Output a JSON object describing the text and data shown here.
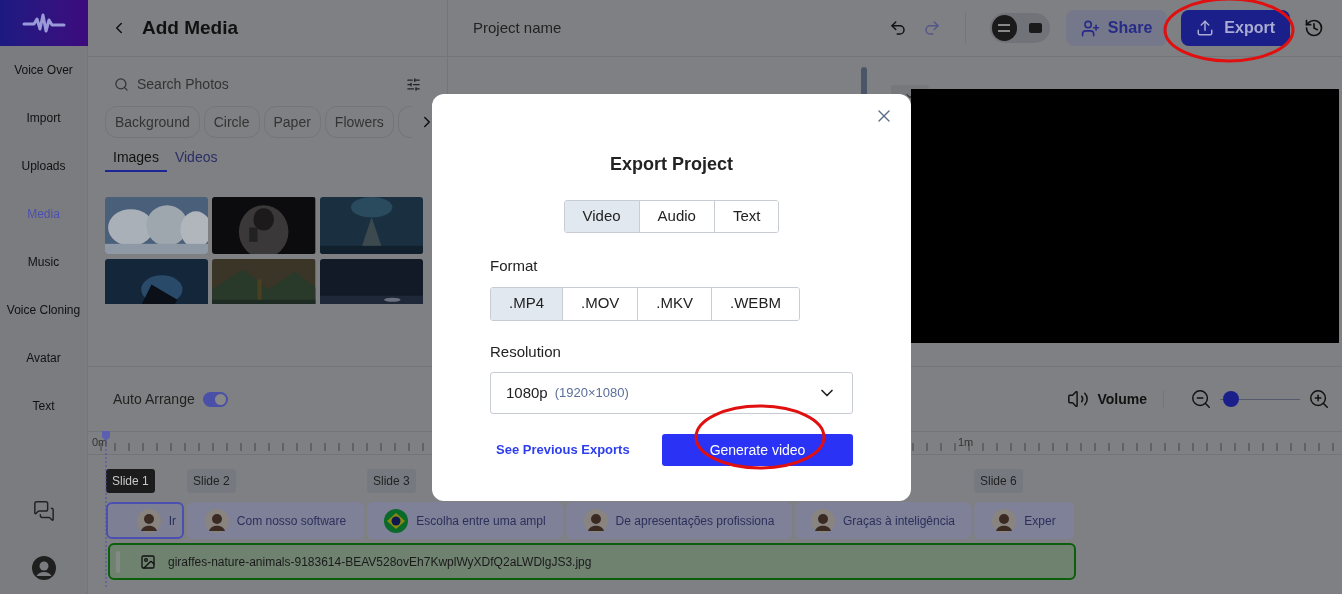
{
  "sidebar": {
    "items": [
      {
        "label": "Voice Over",
        "selected": false
      },
      {
        "label": "Import",
        "selected": false
      },
      {
        "label": "Uploads",
        "selected": false
      },
      {
        "label": "Media",
        "selected": true
      },
      {
        "label": "Music",
        "selected": false
      },
      {
        "label": "Voice Cloning",
        "selected": false
      },
      {
        "label": "Avatar",
        "selected": false
      },
      {
        "label": "Text",
        "selected": false
      }
    ]
  },
  "media_panel": {
    "title": "Add Media",
    "search": {
      "placeholder": "Search Photos"
    },
    "chips": [
      "Background",
      "Circle",
      "Paper",
      "Flowers"
    ],
    "tabs": [
      {
        "label": "Images",
        "selected": true
      },
      {
        "label": "Videos",
        "selected": false
      }
    ]
  },
  "header": {
    "project_name": "Project name",
    "view_modes": [
      {
        "selected": true
      },
      {
        "selected": false
      }
    ],
    "share": "Share",
    "export": "Export"
  },
  "timeline": {
    "auto_arrange": {
      "label": "Auto Arrange",
      "on": true
    },
    "volume": "Volume",
    "zoom": {
      "level": 0.05
    },
    "ruler_labels": [
      "0m",
      "1m"
    ],
    "slides": [
      {
        "label": "Slide 1",
        "selected": true,
        "clip": {
          "text": "Ir",
          "kind": "person"
        }
      },
      {
        "label": "Slide 2",
        "selected": false,
        "clip": {
          "text": "Com nosso software",
          "kind": "person"
        }
      },
      {
        "label": "Slide 3",
        "selected": false,
        "clip": {
          "text": "Escolha entre uma ampl",
          "kind": "flag"
        }
      },
      {
        "selected": false,
        "clip": {
          "text": "De apresentações profissiona",
          "kind": "person"
        }
      },
      {
        "selected": false,
        "clip": {
          "text": "Graças à inteligência",
          "kind": "person"
        }
      },
      {
        "label": "Slide 6",
        "selected": false,
        "clip": {
          "text": "Exper",
          "kind": "person"
        }
      }
    ],
    "media_track": {
      "file": "giraffes-nature-animals-9183614-BEAV528ovEh7KwplWyXDfQ2aLWDlgJS3.jpg"
    }
  },
  "dialog": {
    "title": "Export Project",
    "type_tabs": [
      {
        "label": "Video",
        "selected": true
      },
      {
        "label": "Audio",
        "selected": false
      },
      {
        "label": "Text",
        "selected": false
      }
    ],
    "format_label": "Format",
    "formats": [
      {
        "label": ".MP4",
        "selected": true
      },
      {
        "label": ".MOV",
        "selected": false
      },
      {
        "label": ".MKV",
        "selected": false
      },
      {
        "label": ".WEBM",
        "selected": false
      }
    ],
    "resolution_label": "Resolution",
    "resolution": {
      "value": "1080p",
      "detail": "(1920×1080)"
    },
    "link": "See Previous Exports",
    "button": "Generate video"
  }
}
